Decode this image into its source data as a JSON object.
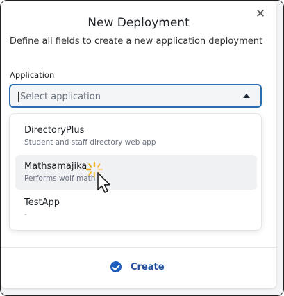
{
  "dialog": {
    "title": "New Deployment",
    "subtitle": "Define all fields to create a new application deployment",
    "close_symbol": "✕"
  },
  "application_field": {
    "label": "Application",
    "placeholder": "Select application",
    "caret_icon": "caret-up-icon"
  },
  "options": [
    {
      "name": "DirectoryPlus",
      "description": "Student and staff directory web app",
      "hovered": false
    },
    {
      "name": "Mathsamajika",
      "description": "Performs wolf math",
      "hovered": true
    },
    {
      "name": "TestApp",
      "description": "-",
      "hovered": false
    }
  ],
  "footer": {
    "create_label": "Create",
    "create_icon": "check-circle-icon"
  },
  "colors": {
    "accent": "#1f5fbf",
    "focus_border": "#2b6cb0",
    "spinner": "#f2b824"
  }
}
